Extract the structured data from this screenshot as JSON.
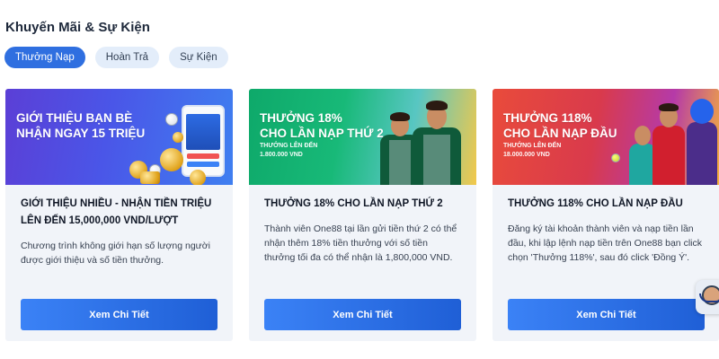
{
  "page": {
    "title": "Khuyến Mãi & Sự Kiện"
  },
  "tabs": [
    {
      "label": "Thưởng Nạp",
      "active": true
    },
    {
      "label": "Hoàn Trả",
      "active": false
    },
    {
      "label": "Sự Kiện",
      "active": false
    }
  ],
  "cards": [
    {
      "banner": {
        "line1": "GIỚI THIỆU BẠN BÈ",
        "line2": "NHẬN NGAY 15 TRIỆU",
        "sub1": "",
        "sub2": ""
      },
      "title": "GIỚI THIỆU NHIỀU - NHẬN TIỀN TRIỆU LÊN ĐẾN 15,000,000 VND/LƯỢT",
      "description": "Chương trình không giới hạn số lượng người được giới thiệu và số tiền thưởng.",
      "cta": "Xem Chi Tiết"
    },
    {
      "banner": {
        "line1": "THƯỞNG 18%",
        "line2": "CHO LẦN NẠP THỨ 2",
        "sub1": "THƯỞNG LÊN ĐẾN",
        "sub2": "1.800.000 VND"
      },
      "title": "THƯỞNG 18% CHO LẦN NẠP THỨ 2",
      "description": "Thành viên One88 tại lần gửi tiền thứ 2 có thể nhận thêm 18% tiền thưởng với số tiền thưởng tối đa có thể nhận là 1,800,000 VND.",
      "cta": "Xem Chi Tiết"
    },
    {
      "banner": {
        "line1": "THƯỞNG 118%",
        "line2": "CHO LẦN NẠP ĐẦU",
        "sub1": "THƯỞNG LÊN ĐẾN",
        "sub2": "18.000.000 VND"
      },
      "title": "THƯỞNG 118% CHO LẦN NẠP ĐẦU",
      "description": "Đăng ký tài khoản thành viên và nạp tiền lần đầu, khi lập lệnh nạp tiền trên One88 bạn click chọn 'Thưởng 118%', sau đó click 'Đồng Ý'.",
      "cta": "Xem Chi Tiết"
    }
  ],
  "colors": {
    "accent": "#2f6fe0",
    "tab_inactive": "#e3edfa",
    "card_bg": "#f1f4f9",
    "button": "#2563eb"
  },
  "icons": {
    "chat": "customer-support-icon"
  }
}
